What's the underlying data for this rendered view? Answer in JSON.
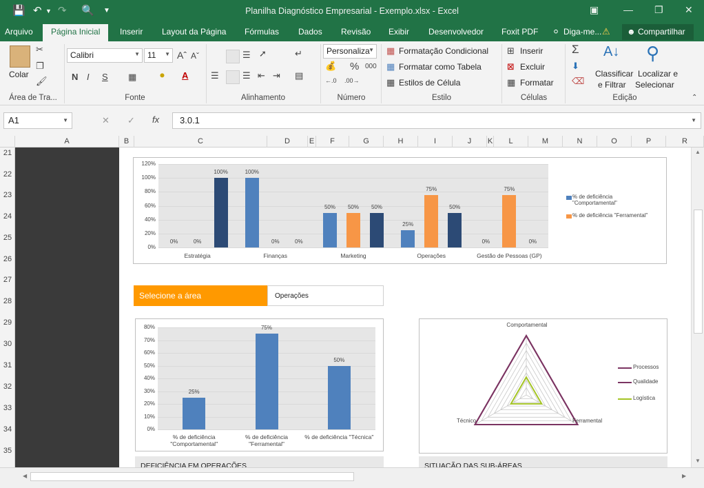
{
  "window": {
    "title": "Planilha Diagnóstico Empresarial - Exemplo.xlsx - Excel"
  },
  "tabs": [
    "Arquivo",
    "Página Inicial",
    "Inserir",
    "Layout da Página",
    "Fórmulas",
    "Dados",
    "Revisão",
    "Exibir",
    "Desenvolvedor",
    "Foxit PDF"
  ],
  "tell_me": "Diga-me...",
  "share_label": "Compartilhar",
  "ribbon": {
    "clipboard": {
      "paste": "Colar",
      "label": "Área de Tra..."
    },
    "font": {
      "name": "Calibri",
      "size": "11",
      "label": "Fonte",
      "bold": "N",
      "italic": "I",
      "underline": "S"
    },
    "alignment": {
      "label": "Alinhamento"
    },
    "number": {
      "format": "Personaliza",
      "percent": "%",
      "thousands": "000",
      "label": "Número"
    },
    "styles": {
      "conditional": "Formatação Condicional",
      "table": "Formatar como Tabela",
      "cell": "Estilos de Célula",
      "label": "Estilo"
    },
    "cells": {
      "insert": "Inserir",
      "delete": "Excluir",
      "format": "Formatar",
      "label": "Células"
    },
    "editing": {
      "sort1": "Classificar",
      "sort2": "e Filtrar",
      "find1": "Localizar e",
      "find2": "Selecionar",
      "label": "Edição"
    }
  },
  "formula_bar": {
    "cell": "A1",
    "fx": "fx",
    "value": "3.0.1"
  },
  "columns": [
    "A",
    "B",
    "C",
    "D",
    "E",
    "F",
    "G",
    "H",
    "I",
    "J",
    "K",
    "L",
    "M",
    "N",
    "O",
    "P",
    "R"
  ],
  "rows": [
    "21",
    "22",
    "23",
    "24",
    "25",
    "26",
    "27",
    "28",
    "29",
    "30",
    "31",
    "32",
    "33",
    "34",
    "35"
  ],
  "selector": {
    "label": "Selecione a área",
    "value": "Operações"
  },
  "bottom_headers": {
    "left": "DEFICIÊNCIA EM OPERAÇÕES",
    "right": "SITUAÇÃO DAS SUB-ÁREAS"
  },
  "colors": {
    "ribbon_green": "#217346",
    "blue": "#4f81bd",
    "orange": "#f79646",
    "navy": "#2c4a75",
    "purple": "#7b3462",
    "lime": "#a4c424",
    "selector_orange": "#ff9900"
  },
  "chart_data": [
    {
      "type": "bar",
      "categories": [
        "Estratégia",
        "Finanças",
        "Marketing",
        "Operações",
        "Gestão de Pessoas (GP)"
      ],
      "series": [
        {
          "name": "% de deficiência \"Comportamental\"",
          "values": [
            0,
            100,
            50,
            25,
            0
          ],
          "labels": [
            "0%",
            "100%",
            "50%",
            "25%",
            "0%"
          ]
        },
        {
          "name": "% de deficiência \"Ferramental\"",
          "values": [
            0,
            0,
            50,
            75,
            75
          ],
          "labels": [
            "0%",
            "0%",
            "50%",
            "75%",
            "75%"
          ]
        },
        {
          "name": "",
          "values": [
            100,
            0,
            50,
            50,
            0
          ],
          "labels": [
            "100%",
            "0%",
            "50%",
            "50%",
            "0%"
          ]
        }
      ],
      "ylim": [
        0,
        120
      ],
      "yticks": [
        "0%",
        "20%",
        "40%",
        "60%",
        "80%",
        "100%",
        "120%"
      ],
      "legend": "right"
    },
    {
      "type": "bar",
      "categories": [
        "% de deficiência \"Comportamental\"",
        "% de deficiência \"Ferramental\"",
        "% de deficiência \"Técnica\""
      ],
      "series": [
        {
          "name": "",
          "values": [
            25,
            75,
            50
          ],
          "labels": [
            "25%",
            "75%",
            "50%"
          ]
        }
      ],
      "ylim": [
        0,
        80
      ],
      "yticks": [
        "0%",
        "10%",
        "20%",
        "30%",
        "40%",
        "50%",
        "60%",
        "70%",
        "80%"
      ]
    },
    {
      "type": "radar",
      "axes": [
        "Comportamental",
        "Ferramental",
        "Técnico"
      ],
      "series": [
        {
          "name": "Processos",
          "values": [
            1,
            1,
            1
          ]
        },
        {
          "name": "Qualidade",
          "values": [
            1,
            1,
            1
          ]
        },
        {
          "name": "Logística",
          "values": [
            0.3,
            0.3,
            0.3
          ]
        }
      ],
      "legend": "right"
    }
  ]
}
